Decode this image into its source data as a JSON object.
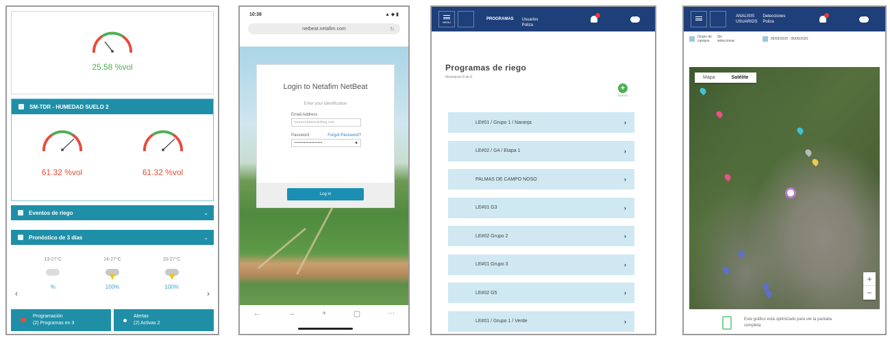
{
  "phone1": {
    "top_gauge_value": "25.58 %vol",
    "sensor_panel_title": "SM-TDR - HUMEDAD SUELO 2",
    "gauge_left_value": "61.32 %vol",
    "gauge_right_value": "61.32 %vol",
    "irrigation_events_label": "Eventos de riego",
    "forecast_label": "Pronóstico de 3 días",
    "forecast": [
      {
        "temp": "13-27°C",
        "pct": "%",
        "icon": "cloudy-icon"
      },
      {
        "temp": "14-27°C",
        "pct": "100%",
        "icon": "storm-icon"
      },
      {
        "temp": "20-27°C",
        "pct": "100%",
        "icon": "storm-icon"
      }
    ],
    "programs_button": {
      "line1": "Programación",
      "line2": "(2) Programas en 3"
    },
    "alerts_button": {
      "line1": "Alertas",
      "line2": "(2) Activas 2"
    },
    "colors": {
      "teal": "#1f8fa8",
      "green": "#4caf50",
      "red": "#e74c3c"
    }
  },
  "phone2": {
    "time": "10:38",
    "status_icons": "▲ ◆ ▮",
    "url": "netbeat.netafim.com",
    "login_title": "Login to Netafim NetBeat",
    "login_subtitle": "Enter your identification",
    "email_label": "Email Address",
    "email_placeholder": "tomas.beatconsulting.com",
    "password_label": "Password",
    "forgot_link": "Forgot Password?",
    "password_value": "••••••••••••••••••",
    "login_button": "Log in",
    "nav": {
      "back": "←",
      "forward": "→",
      "add": "+",
      "tabs": "▢",
      "more": "···"
    }
  },
  "phone3": {
    "nav": {
      "menu_label": "MENU",
      "programs": "PROGRAMAS",
      "users_line1": "Usuarios",
      "users_line2": "Poliza"
    },
    "title": "Programas de riego",
    "subtitle": "Mostrando 8 de 8",
    "add_label": "NUEVO",
    "programs": [
      "LE#01 / Grupo 1 / Naranja",
      "LE#02 / G4 / Etapa 1",
      "PALMAS DE CAMPO NOSO",
      "LE#01 G3",
      "LE#02 Grupo 2",
      "LE#01 Grupo 3",
      "LE#02 G5",
      "LE#01 / Grupo 1 / Verde"
    ],
    "colors": {
      "nav": "#1e3f7a",
      "item": "#cfe8f2"
    }
  },
  "phone4": {
    "nav": {
      "item1_line1": "ANALISIS",
      "item1_line2": "USUARIOS",
      "item2_line1": "Detecciones",
      "item2_line2": "Poliza"
    },
    "filter": {
      "zone_line1": "Grupo de",
      "zone_line2": "campos",
      "zone_value_line1": "Sin",
      "zone_value_line2": "seleccionar",
      "dates": "06/05/2020 - 05/06/2020"
    },
    "map_type_map": "Mapa",
    "map_type_satellite": "Satélite",
    "zoom_in": "+",
    "zoom_out": "−",
    "footer_text": "Este gráfico está optimizado para ver la pantalla completa"
  }
}
